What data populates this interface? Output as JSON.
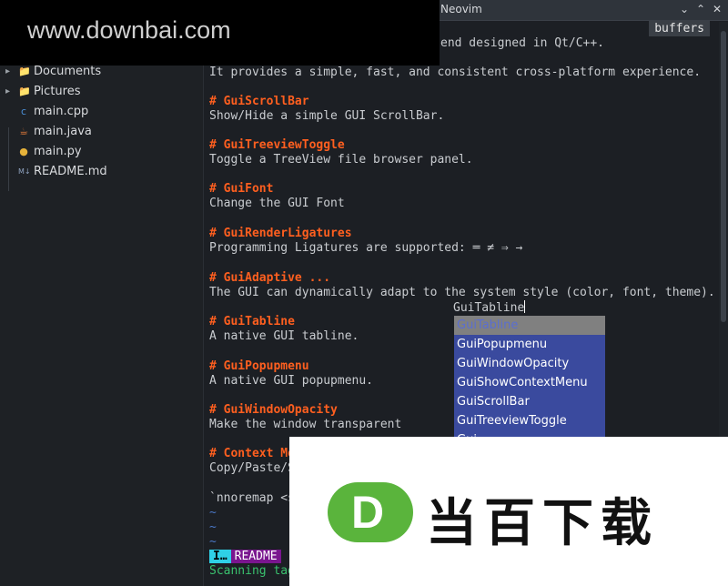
{
  "window": {
    "title": "Neovim",
    "minimize": "⌄",
    "maximize": "⌃",
    "close": "✕"
  },
  "buffers_label": "buffers",
  "sidebar": {
    "items": [
      {
        "label": "Documents",
        "type": "folder",
        "icon": "folder-icon"
      },
      {
        "label": "Pictures",
        "type": "folder",
        "icon": "folder-icon"
      },
      {
        "label": "main.cpp",
        "type": "file",
        "icon": "cpp-icon"
      },
      {
        "label": "main.java",
        "type": "file",
        "icon": "java-icon"
      },
      {
        "label": "main.py",
        "type": "file",
        "icon": "python-icon"
      },
      {
        "label": "README.md",
        "type": "file",
        "icon": "markdown-icon"
      }
    ]
  },
  "editor": {
    "lines": [
      "end designed in Qt/C++.",
      "",
      "It provides a simple, fast, and consistent cross-platform experience.",
      "",
      "# GuiScrollBar",
      "Show/Hide a simple GUI ScrollBar.",
      "",
      "# GuiTreeviewToggle",
      "Toggle a TreeView file browser panel.",
      "",
      "# GuiFont",
      "Change the GUI Font",
      "",
      "# GuiRenderLigatures",
      "Programming Ligatures are supported: ═ ≠ ⇒ →",
      "",
      "# GuiAdaptive ...",
      "The GUI can dynamically adapt to the system style (color, font, theme).",
      "GuiTabline",
      "# GuiTabline",
      "A native GUI tabline.",
      "",
      "# GuiPopupmenu",
      "A native GUI popupmenu.",
      "",
      "# GuiWindowOpacity",
      "Make the window transparent",
      "",
      "# Context Me",
      "Copy/Paste/S",
      "",
      "`nnoremap <s",
      "~",
      "~",
      "~"
    ]
  },
  "popup": {
    "items": [
      "GuiTabline",
      "GuiPopupmenu",
      "GuiWindowOpacity",
      "GuiShowContextMenu",
      "GuiScrollBar",
      "GuiTreeviewToggle",
      "Gui"
    ]
  },
  "status": {
    "mode": "I…",
    "buffer": "README",
    "message": "Scanning tag"
  },
  "watermark": {
    "url": "www.downbai.com",
    "ad_text": "当百下载",
    "ad_letter": "D"
  }
}
